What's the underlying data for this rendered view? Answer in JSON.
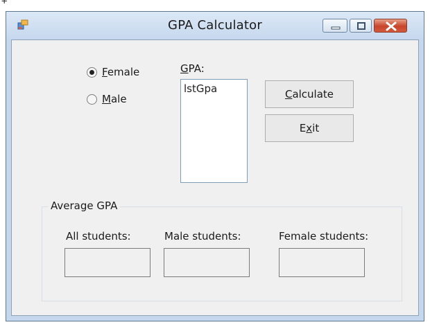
{
  "window": {
    "title": "GPA Calculator"
  },
  "gender": {
    "female": {
      "label_mnemonic": "F",
      "label_rest": "emale",
      "selected": true
    },
    "male": {
      "label_mnemonic": "M",
      "label_rest": "ale",
      "selected": false
    }
  },
  "gpa": {
    "label_mnemonic": "G",
    "label_rest": "PA:",
    "listbox_item": "lstGpa"
  },
  "buttons": {
    "calculate": {
      "mnemonic": "C",
      "rest": "alculate"
    },
    "exit": {
      "pre": "E",
      "mnemonic": "x",
      "rest": "it"
    }
  },
  "average": {
    "title": "Average GPA",
    "all_label": "All students:",
    "male_label": "Male students:",
    "female_label": "Female students:",
    "all_value": "",
    "male_value": "",
    "female_value": ""
  }
}
